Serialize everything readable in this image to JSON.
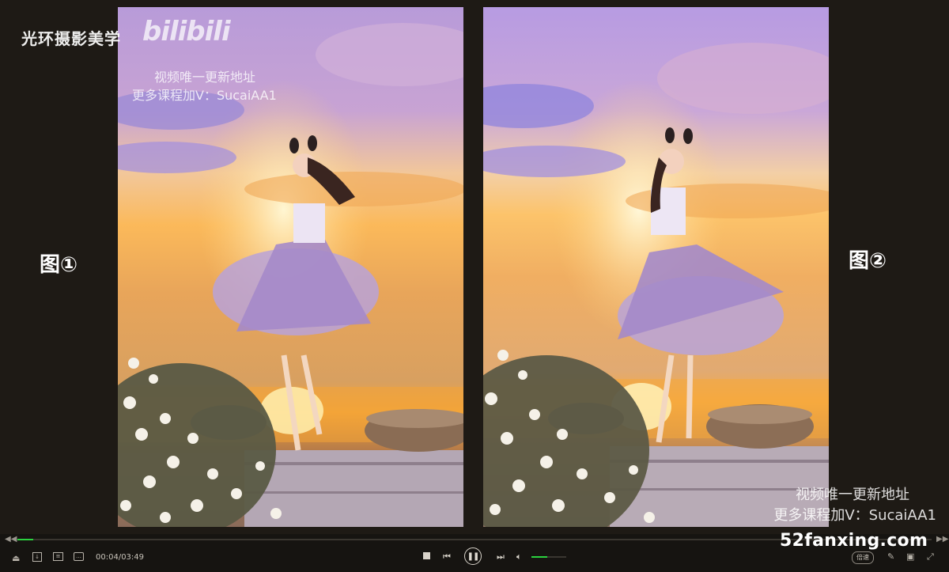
{
  "overlay": {
    "channel_name": "光环摄影美学",
    "bilibili_logo": "bilibili",
    "watermark_top_line1": "视频唯一更新地址",
    "watermark_top_line2": "更多课程加V：SucaiAA1",
    "watermark_bottom_line1": "视频唯一更新地址",
    "watermark_bottom_line2": "更多课程加V：SucaiAA1",
    "figure_label_1": "图①",
    "figure_label_2": "图②",
    "site_watermark": "52fanxing.com"
  },
  "player": {
    "time_display": "00:04/03:49",
    "progress_fraction": 0.017,
    "volume_fraction": 0.45,
    "speed_label": "倍速",
    "accent_color": "#2bd23f",
    "icons": {
      "rewind": "seek-back-icon",
      "forward": "seek-forward-icon",
      "eject": "eject-icon",
      "screenshot": "screenshot-icon",
      "subtitle": "subtitle-icon",
      "danmaku": "danmaku-icon",
      "stop": "stop-icon",
      "prev": "previous-icon",
      "play_pause": "pause-icon",
      "next": "next-icon",
      "volume": "volume-icon",
      "draw": "brush-icon",
      "pip": "picture-in-picture-icon",
      "fullscreen": "fullscreen-icon"
    }
  }
}
